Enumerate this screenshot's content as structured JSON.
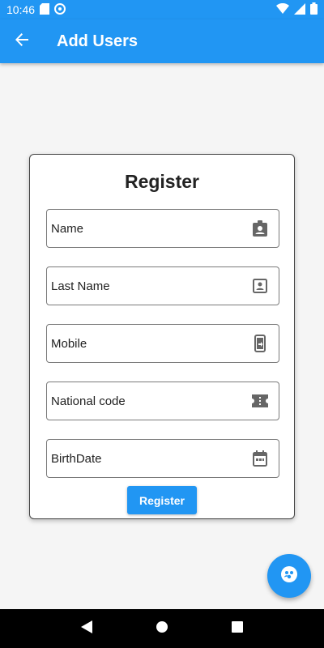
{
  "status_bar": {
    "time": "10:46",
    "icons": [
      "sd-card-icon",
      "vpn-icon",
      "wifi-icon",
      "signal-icon",
      "battery-icon"
    ]
  },
  "app_bar": {
    "title": "Add Users",
    "back_icon": "arrow-back-icon"
  },
  "form": {
    "title": "Register",
    "fields": [
      {
        "label": "Name",
        "icon": "badge-icon"
      },
      {
        "label": "Last Name",
        "icon": "contact-card-icon"
      },
      {
        "label": "Mobile",
        "icon": "phone-forward-icon"
      },
      {
        "label": "National code",
        "icon": "ticket-icon"
      },
      {
        "label": "BirthDate",
        "icon": "calendar-icon"
      }
    ],
    "submit_label": "Register"
  },
  "fab": {
    "icon": "group-icon"
  },
  "nav_bar": {
    "icons": [
      "back-triangle-icon",
      "home-circle-icon",
      "recents-square-icon"
    ]
  },
  "colors": {
    "primary": "#2196f3",
    "card_border": "#444444",
    "background": "#f5f5f5"
  }
}
